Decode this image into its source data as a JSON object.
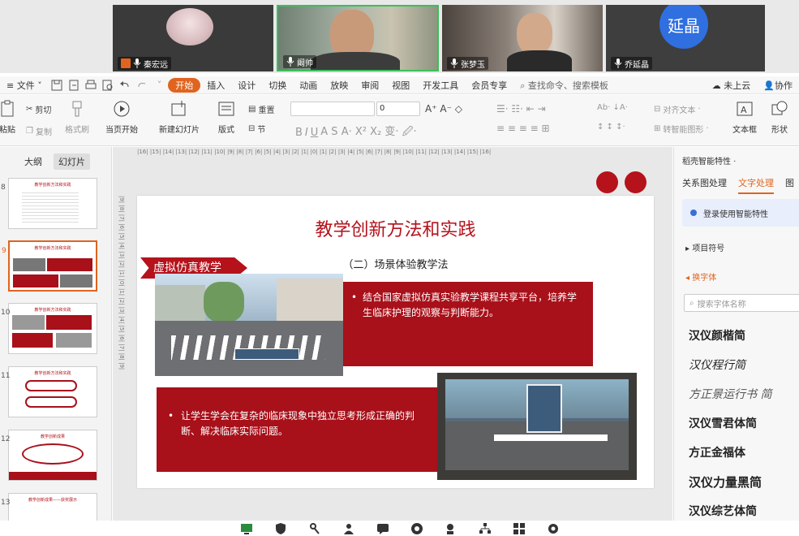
{
  "video_tiles": [
    {
      "name": "秦宏远"
    },
    {
      "name": "阚帅"
    },
    {
      "name": "张梦玉"
    },
    {
      "name": "乔延晶",
      "avatar_text": "延晶"
    }
  ],
  "menu": {
    "file": "文件",
    "tabs": [
      "开始",
      "插入",
      "设计",
      "切换",
      "动画",
      "放映",
      "审阅",
      "视图",
      "开发工具",
      "会员专享"
    ],
    "search": "查找命令、搜索模板",
    "cloud": "未上云",
    "collab": "协作"
  },
  "ribbon": {
    "paste": "粘贴",
    "cut": "剪切",
    "copy": "复制",
    "format_painter": "格式刷",
    "play_from_current": "当页开始",
    "new_slide": "新建幻灯片",
    "layout": "版式",
    "section": "节",
    "reset": "重置",
    "font_size": "0",
    "align_text": "对齐文本",
    "smart_art": "转智能图形",
    "text_box": "文本框",
    "shape": "形状"
  },
  "left_panel": {
    "tabs": [
      "大纲",
      "幻灯片"
    ],
    "active_tab": "幻灯片",
    "thumbnails": [
      {
        "num": "8",
        "title": "教学创新方法和实践",
        "selected": false
      },
      {
        "num": "9",
        "title": "教学创新方法和实践",
        "selected": true
      },
      {
        "num": "10",
        "title": "教学创新方法和实践",
        "selected": false
      },
      {
        "num": "11",
        "title": "教学创新方法和实践",
        "selected": false
      },
      {
        "num": "12",
        "title": "教学创新成果",
        "selected": false
      },
      {
        "num": "13",
        "title": "教学创新成果——获奖展示",
        "selected": false
      }
    ]
  },
  "slide": {
    "title": "教学创新方法和实践",
    "subtitle": "（二）场景体验教学法",
    "tag": "虚拟仿真教学",
    "bullet1": "结合国家虚拟仿真实验教学课程共享平台，培养学生临床护理的观察与判断能力。",
    "bullet2": "让学生学会在复杂的临床现象中独立思考形成正确的判断、解决临床实际问题。"
  },
  "right_panel": {
    "header": "稻壳智能特性",
    "tabs": [
      "关系图处理",
      "文字处理",
      "图"
    ],
    "active_tab": "文字处理",
    "login": "登录使用智能特性",
    "sections": [
      "项目符号",
      "换字体"
    ],
    "font_search_placeholder": "搜索字体名称",
    "fonts": [
      "汉仪颜楷简",
      "汉仪程行简",
      "方正景运行书 简",
      "汉仪雪君体简",
      "方正金福体",
      "汉仪力量黑简",
      "汉仪综艺体简"
    ]
  },
  "colors": {
    "brand_red": "#b5121b",
    "accent_orange": "#e0641e"
  }
}
